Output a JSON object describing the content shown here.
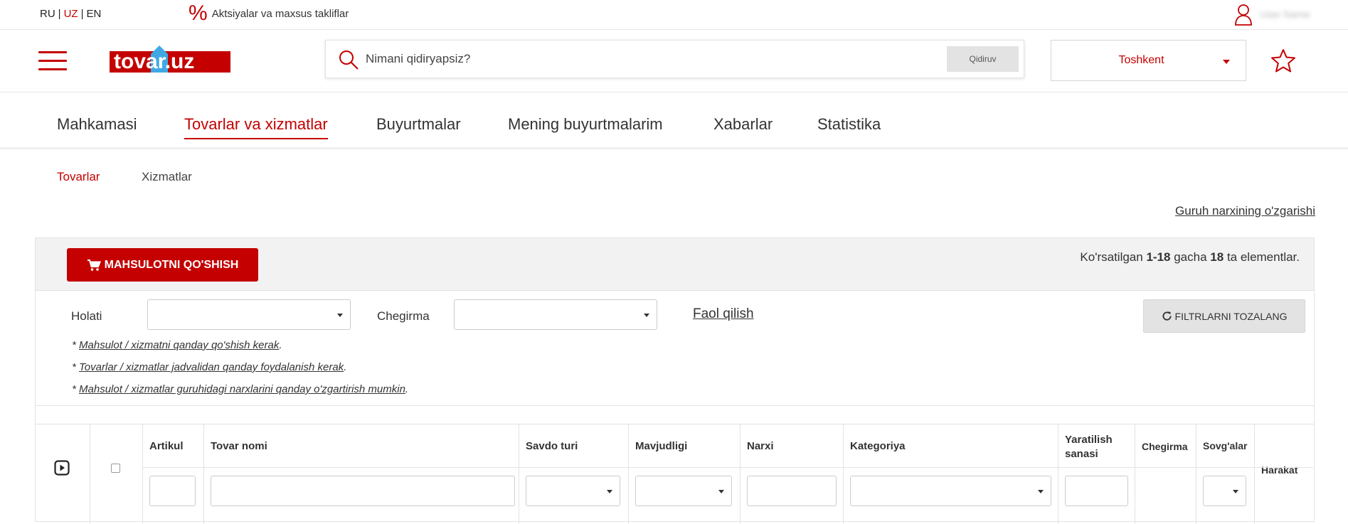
{
  "lang": {
    "items": [
      "RU",
      "UZ",
      "EN"
    ],
    "active": "UZ"
  },
  "promo": {
    "symbol": "%",
    "text": "Aktsiyalar va maxsus takliflar"
  },
  "user": {
    "name": "User Name"
  },
  "logo": {
    "text": "tovar.uz"
  },
  "search": {
    "placeholder": "Nimani qidiryapsiz?",
    "button": "Qidiruv"
  },
  "city": {
    "value": "Toshkent"
  },
  "main_nav": [
    {
      "label": "Mahkamasi"
    },
    {
      "label": "Tovarlar va xizmatlar"
    },
    {
      "label": "Buyurtmalar"
    },
    {
      "label": "Mening buyurtmalarim"
    },
    {
      "label": "Xabarlar"
    },
    {
      "label": "Statistika"
    }
  ],
  "main_nav_active": "Tovarlar va xizmatlar",
  "sub_nav": [
    {
      "label": "Tovarlar"
    },
    {
      "label": "Xizmatlar"
    }
  ],
  "sub_nav_active": "Tovarlar",
  "group_price_link": "Guruh narxining o'zgarishi",
  "add_button": "MAHSULOTNI QO'SHISH",
  "counter": {
    "prefix": "Ko'rsatilgan",
    "range": "1-18",
    "mid": "gacha",
    "total": "18",
    "suffix": "ta elementlar."
  },
  "filters": {
    "status_label": "Holati",
    "status_value": "",
    "discount_label": "Chegirma",
    "discount_value": "",
    "activate_link": "Faol qilish",
    "clear_button": "FILTRLARNI TOZALANG"
  },
  "help_links": [
    {
      "prefix": "* ",
      "link": "Mahsulot / xizmatni qanday qo'shish kerak",
      "suffix": "."
    },
    {
      "prefix": "* ",
      "link": "Tovarlar / xizmatlar jadvalidan qanday foydalanish kerak",
      "suffix": "."
    },
    {
      "prefix": "* ",
      "link": "Mahsulot / xizmatlar guruhidagi narxlarini qanday o'zgartirish mumkin",
      "suffix": "."
    }
  ],
  "table": {
    "columns": {
      "artikul": "Artikul",
      "name": "Tovar nomi",
      "trade_type": "Savdo turi",
      "availability": "Mavjudligi",
      "price": "Narxi",
      "category": "Kategoriya",
      "created_line1": "Yaratilish",
      "created_line2": "sanasi",
      "discount": "Chegirma",
      "gifts": "Sovg'alar",
      "action": "Harakat"
    }
  },
  "colors": {
    "accent": "#c40000",
    "panel_bg": "#f2f2f2",
    "border": "#e3e3e3"
  }
}
